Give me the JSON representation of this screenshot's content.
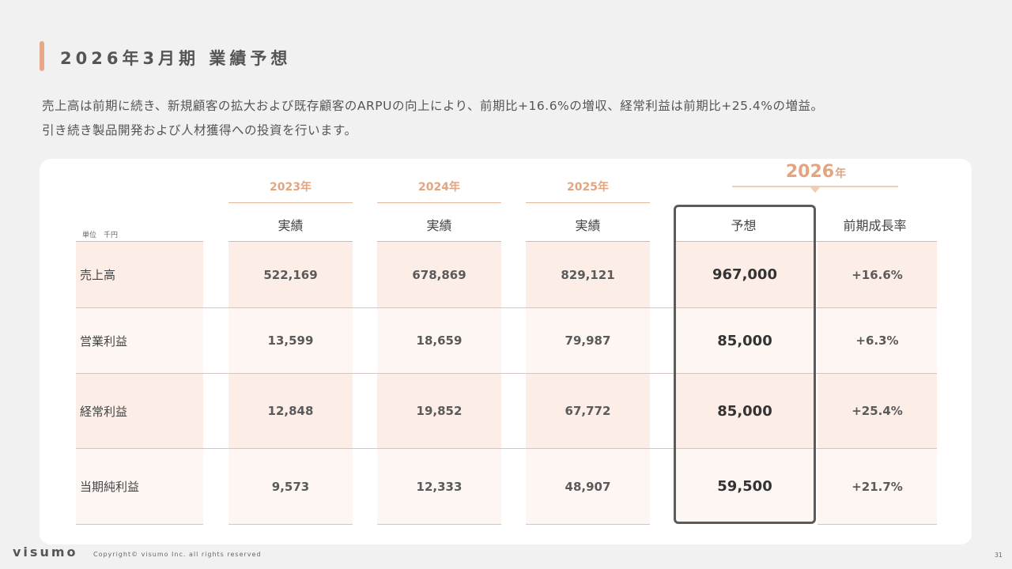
{
  "slide": {
    "title": "2026年3月期 業績予想",
    "description_lines": [
      "売上高は前期に続き、新規顧客の拡大および既存顧客のARPUの向上により、前期比+16.6%の増収、経常利益は前期比+25.4%の増益。",
      "引き続き製品開発および人材獲得への投資を行います。"
    ]
  },
  "table": {
    "unit_label": "単位　千円",
    "years": [
      "2023年",
      "2024年",
      "2025年"
    ],
    "forecast_year": "2026",
    "forecast_year_suffix": "年",
    "headers": [
      "実績",
      "実績",
      "実績",
      "予想",
      "前期成長率"
    ],
    "rows": [
      {
        "label": "売上高",
        "values": [
          "522,169",
          "678,869",
          "829,121"
        ],
        "forecast": "967,000",
        "growth": "+16.6%"
      },
      {
        "label": "営業利益",
        "values": [
          "13,599",
          "18,659",
          "79,987"
        ],
        "forecast": "85,000",
        "growth": "+6.3%"
      },
      {
        "label": "経常利益",
        "values": [
          "12,848",
          "19,852",
          "67,772"
        ],
        "forecast": "85,000",
        "growth": "+25.4%"
      },
      {
        "label": "当期純利益",
        "values": [
          "9,573",
          "12,333",
          "48,907"
        ],
        "forecast": "59,500",
        "growth": "+21.7%"
      }
    ]
  },
  "footer": {
    "logo": "visumo",
    "copyright": "Copyright© visumo Inc. all rights reserved",
    "page_number": "31"
  },
  "colors": {
    "accent": "#e4a47f",
    "row_fill_primary": "#fcede7",
    "row_fill_secondary": "#fdf6f3",
    "forecast_border": "#5b5b5b"
  }
}
